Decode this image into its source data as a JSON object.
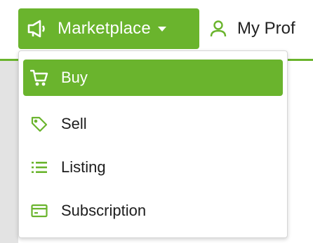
{
  "nav": {
    "marketplace_label": "Marketplace",
    "marketplace_icon": "megaphone-icon",
    "profile_label": "My Prof",
    "profile_icon": "user-icon"
  },
  "dropdown": {
    "items": [
      {
        "label": "Buy",
        "icon": "cart-icon",
        "active": true
      },
      {
        "label": "Sell",
        "icon": "tag-icon",
        "active": false
      },
      {
        "label": "Listing",
        "icon": "list-icon",
        "active": false
      },
      {
        "label": "Subscription",
        "icon": "card-icon",
        "active": false
      }
    ]
  },
  "colors": {
    "accent": "#6ab42d",
    "text": "#1d1d1d"
  }
}
